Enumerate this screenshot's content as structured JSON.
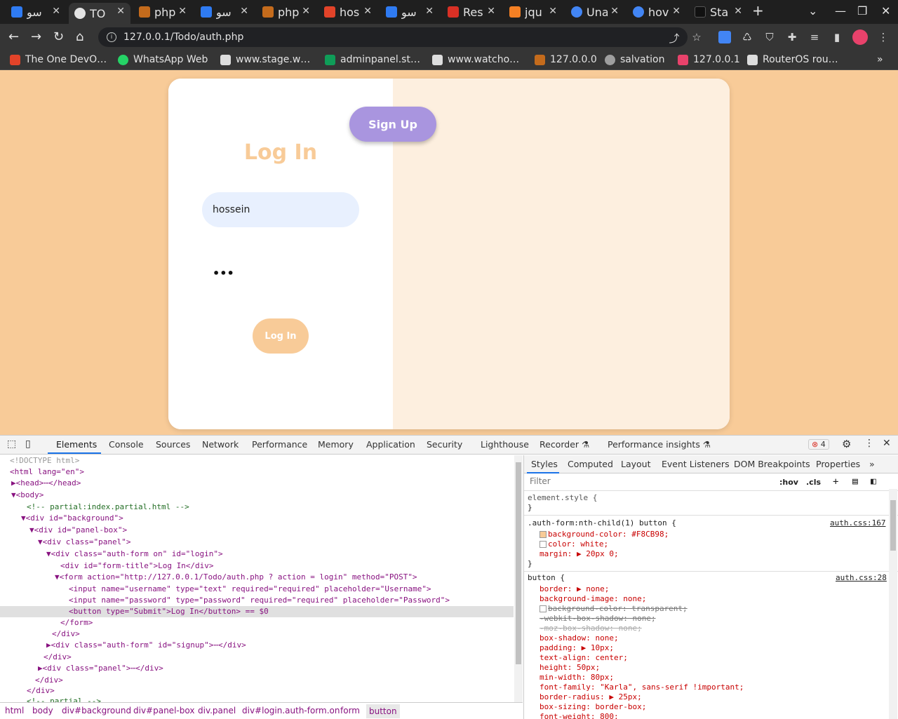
{
  "tabs": [
    {
      "title": "سو",
      "fav": "#2f7bf2"
    },
    {
      "title": "TO",
      "fav": "#e3e3e3"
    },
    {
      "title": "php",
      "fav": "#c46b1c"
    },
    {
      "title": "سو",
      "fav": "#2f7bf2"
    },
    {
      "title": "php",
      "fav": "#c46b1c"
    },
    {
      "title": "hos",
      "fav": "#e24329"
    },
    {
      "title": "سو",
      "fav": "#2f7bf2"
    },
    {
      "title": "Res",
      "fav": "#d93025"
    },
    {
      "title": "jqu",
      "fav": "#f48024"
    },
    {
      "title": "Una",
      "fav": "#4285f4"
    },
    {
      "title": "hov",
      "fav": "#4285f4"
    },
    {
      "title": "Sta",
      "fav": "#111111"
    }
  ],
  "new_tab_label": "+",
  "window": {
    "minimize": "—",
    "restore": "❐",
    "close": "✕",
    "tab_list": "⌄"
  },
  "address": {
    "url": "127.0.0.1/Todo/auth.php",
    "info": "i"
  },
  "bookmarks": [
    {
      "label": "The One DevO…",
      "fav": "#e24329"
    },
    {
      "label": "WhatsApp Web",
      "fav": "#25d366"
    },
    {
      "label": "www.stage.w…",
      "fav": "#dddddd"
    },
    {
      "label": "adminpanel.st…",
      "fav": "#0f9d58"
    },
    {
      "label": "www.watcho…",
      "fav": "#dddddd"
    },
    {
      "label": "127.0.0.0",
      "fav": "#c46b1c"
    },
    {
      "label": "salvation",
      "fav": "#9e9e9e"
    },
    {
      "label": "127.0.0.1",
      "fav": "#e8426b"
    },
    {
      "label": "RouterOS rou…",
      "fav": "#dddddd"
    }
  ],
  "bookmarks_more": "»",
  "page": {
    "signup_label": "Sign Up",
    "form_title": "Log In",
    "username_value": "hossein",
    "password_masked": "•••",
    "login_label": "Log In",
    "colors": {
      "bg": "#f8cb98",
      "signup": "#a995df",
      "right_panel": "#fdefdf",
      "input_bg": "#e8f0fe"
    }
  },
  "devtools": {
    "tabs": [
      "Elements",
      "Console",
      "Sources",
      "Network",
      "Performance",
      "Memory",
      "Application",
      "Security",
      "Lighthouse",
      "Recorder ⚗",
      "Performance insights ⚗"
    ],
    "error_count": "4",
    "dom": [
      {
        "t": "<!DOCTYPE html>"
      },
      {
        "t": "<html lang=\"en\">"
      },
      {
        "t": "▶<head>⋯</head>"
      },
      {
        "t": "▼<body>"
      },
      {
        "t": "<!-- partial:index.partial.html -->"
      },
      {
        "t": "▼<div id=\"background\">"
      },
      {
        "t": "▼<div id=\"panel-box\">"
      },
      {
        "t": "▼<div class=\"panel\">"
      },
      {
        "t": "▼<div class=\"auth-form on\" id=\"login\">"
      },
      {
        "t": "<div id=\"form-title\">Log In</div>"
      },
      {
        "t": "▼<form action=\"http://127.0.0.1/Todo/auth.php ? action = login\" method=\"POST\">"
      },
      {
        "t": "<input name=\"username\" type=\"text\" required=\"required\" placeholder=\"Username\">"
      },
      {
        "t": "<input name=\"password\" type=\"password\" required=\"required\" placeholder=\"Password\">"
      },
      {
        "t": "<button type=\"Submit\">Log In</button> == $0"
      },
      {
        "t": "</form>"
      },
      {
        "t": "</div>"
      },
      {
        "t": "▶<div class=\"auth-form\" id=\"signup\">⋯</div>"
      },
      {
        "t": "</div>"
      },
      {
        "t": "▶<div class=\"panel\">⋯</div>"
      },
      {
        "t": "</div>"
      },
      {
        "t": "</div>"
      },
      {
        "t": "<!-- partial -->"
      }
    ],
    "breadcrumbs": [
      "html",
      "body",
      "div#background",
      "div#panel-box",
      "div.panel",
      "div#login.auth-form.on",
      "form",
      "button"
    ],
    "styles_tabs": [
      "Styles",
      "Computed",
      "Layout",
      "Event Listeners",
      "DOM Breakpoints",
      "Properties",
      "»"
    ],
    "filter_placeholder": "Filter",
    "filter_hov": ":hov",
    "filter_cls": ".cls",
    "rules": [
      {
        "selector": "element.style {",
        "lines": [
          "}"
        ]
      },
      {
        "selector": ".auth-form:nth-child(1) button {",
        "source": "auth.css:167",
        "lines": [
          "background-color: #F8CB98;",
          "color: white;",
          "margin: ▶ 20px 0;",
          "}"
        ]
      },
      {
        "selector": "button {",
        "source": "auth.css:28",
        "lines": [
          "border: ▶ none;",
          "background-image: none;",
          "background-color: transparent;",
          "-webkit-box-shadow: none;",
          "-moz-box-shadow: none;",
          "box-shadow: none;",
          "padding: ▶ 10px;",
          "text-align: center;",
          "height: 50px;",
          "min-width: 80px;",
          "font-family: \"Karla\", sans-serif !important;",
          "border-radius: ▶ 25px;",
          "box-sizing: border-box;",
          "font-weight: 800;"
        ]
      }
    ]
  }
}
